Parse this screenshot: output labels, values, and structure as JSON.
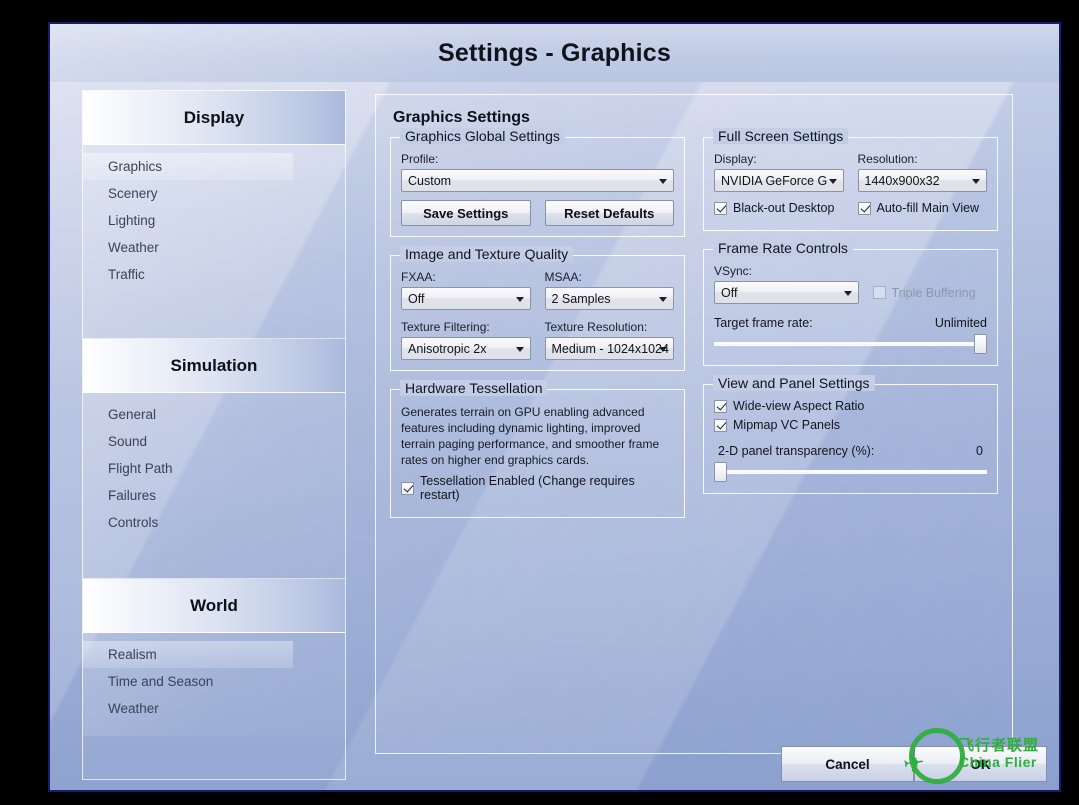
{
  "window": {
    "title": "Settings - Graphics"
  },
  "sidebar": {
    "groups": [
      {
        "header": "Display",
        "items": [
          {
            "label": "Graphics",
            "selected": true
          },
          {
            "label": "Scenery",
            "selected": false
          },
          {
            "label": "Lighting",
            "selected": false
          },
          {
            "label": "Weather",
            "selected": false
          },
          {
            "label": "Traffic",
            "selected": false
          }
        ]
      },
      {
        "header": "Simulation",
        "items": [
          {
            "label": "General",
            "selected": false
          },
          {
            "label": "Sound",
            "selected": false
          },
          {
            "label": "Flight Path",
            "selected": false
          },
          {
            "label": "Failures",
            "selected": false
          },
          {
            "label": "Controls",
            "selected": false
          }
        ]
      },
      {
        "header": "World",
        "items": [
          {
            "label": "Realism",
            "selected": true
          },
          {
            "label": "Time and Season",
            "selected": false
          },
          {
            "label": "Weather",
            "selected": false
          }
        ]
      }
    ]
  },
  "main": {
    "title": "Graphics Settings",
    "graphics_global": {
      "legend": "Graphics Global Settings",
      "profile_label": "Profile:",
      "profile_value": "Custom",
      "save_label": "Save Settings",
      "reset_label": "Reset Defaults"
    },
    "image_texture": {
      "legend": "Image and Texture Quality",
      "fxaa_label": "FXAA:",
      "fxaa_value": "Off",
      "msaa_label": "MSAA:",
      "msaa_value": "2 Samples",
      "filtering_label": "Texture Filtering:",
      "filtering_value": "Anisotropic 2x",
      "resolution_label": "Texture Resolution:",
      "resolution_value": "Medium - 1024x1024"
    },
    "tessellation": {
      "legend": "Hardware Tessellation",
      "description": "Generates terrain on GPU enabling advanced features including dynamic lighting, improved terrain paging performance, and smoother frame rates on higher end graphics cards.",
      "enabled_label": "Tessellation Enabled (Change requires restart)",
      "enabled_checked": true
    },
    "full_screen": {
      "legend": "Full Screen Settings",
      "display_label": "Display:",
      "display_value": "NVIDIA GeForce G",
      "resolution_label": "Resolution:",
      "resolution_value": "1440x900x32",
      "blackout_label": "Black-out Desktop",
      "blackout_checked": true,
      "autofill_label": "Auto-fill Main View",
      "autofill_checked": true
    },
    "frame_rate": {
      "legend": "Frame Rate Controls",
      "vsync_label": "VSync:",
      "vsync_value": "Off",
      "triple_buffering_label": "Triple Buffering",
      "triple_buffering_checked": false,
      "target_label": "Target frame rate:",
      "target_value": "Unlimited"
    },
    "view_panel": {
      "legend": "View and Panel Settings",
      "wideview_label": "Wide-view Aspect Ratio",
      "wideview_checked": true,
      "mipmap_label": "Mipmap VC Panels",
      "mipmap_checked": true,
      "transparency_label": "2-D panel transparency (%):",
      "transparency_value": "0"
    }
  },
  "footer": {
    "cancel_label": "Cancel",
    "ok_label": "OK"
  },
  "watermark": {
    "chinese": "飞行者联盟",
    "english": "China Flier",
    "plane_glyph": "✈",
    "color": "#2fae3e"
  }
}
